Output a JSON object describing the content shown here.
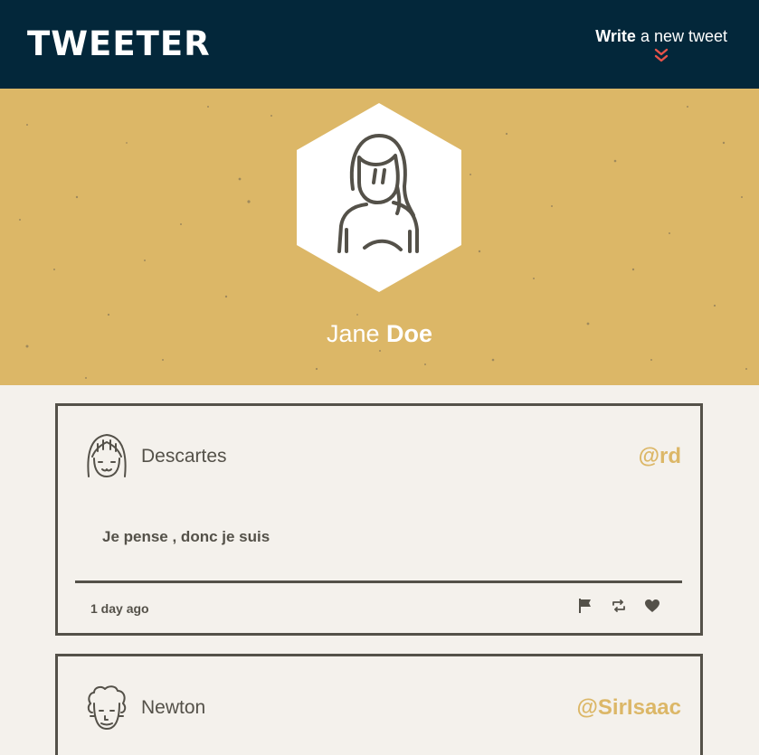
{
  "nav": {
    "brand": "TWEETER",
    "compose_bold": "Write",
    "compose_rest": " a new tweet",
    "compose_icon": "double-chevron-down-icon"
  },
  "profile": {
    "first_name": "Jane",
    "last_name": "Doe",
    "avatar_icon": "woman-avatar-icon"
  },
  "tweets": [
    {
      "name": "Descartes",
      "handle": "@rd",
      "text": "Je pense , donc je suis",
      "time": "1 day ago",
      "avatar_icon": "bangs-avatar-icon"
    },
    {
      "name": "Newton",
      "handle": "@SirIsaac",
      "avatar_icon": "curly-hair-avatar-icon"
    }
  ],
  "actions": [
    "flag-icon",
    "retweet-icon",
    "heart-icon"
  ],
  "colors": {
    "nav_bg": "#03273a",
    "header_bg": "#dcb767",
    "page_bg": "#f4f1ec",
    "text": "#545149",
    "accent": "#dcb767",
    "chevron": "#e8534a"
  }
}
